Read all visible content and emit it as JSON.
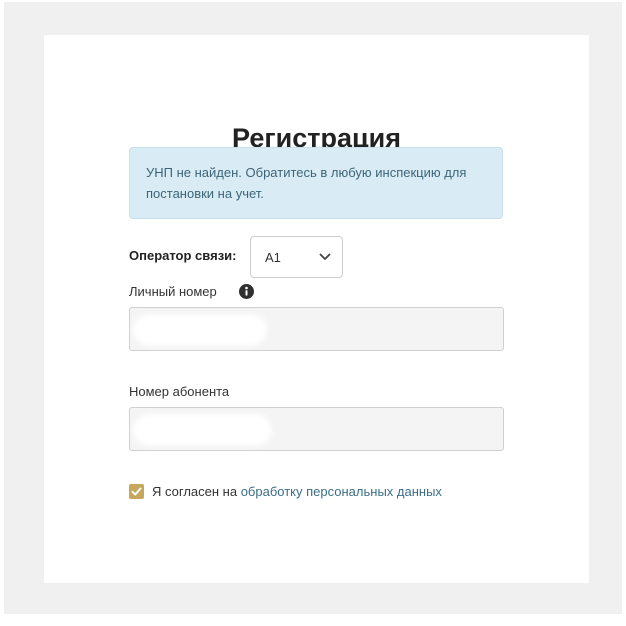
{
  "page": {
    "title": "Регистрация"
  },
  "alert": {
    "message": "УНП не найден. Обратитесь в любую инспекцию для постановки на учет."
  },
  "operator": {
    "label": "Оператор связи:",
    "selected": "А1",
    "icon": "chevron-down-icon"
  },
  "personal_number": {
    "label": "Личный номер",
    "icon": "info-icon",
    "value": ""
  },
  "subscriber_number": {
    "label": "Номер абонента",
    "value": ""
  },
  "consent": {
    "checked": true,
    "text": "Я согласен на",
    "link_text": "обработку персональных данных"
  },
  "colors": {
    "accent": "#c7a75c",
    "alert_bg": "#d9ecf5",
    "alert_text": "#3c6577",
    "link": "#3b6f88",
    "page_bg": "#f0f0f0"
  }
}
